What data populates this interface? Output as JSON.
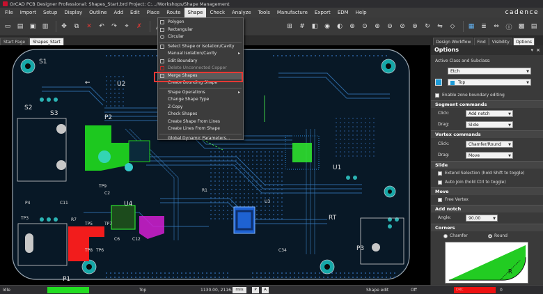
{
  "window": {
    "title": "OrCAD PCB Designer Professional: Shapes_Start.brd  Project: C:.../Workshops/Shape Management",
    "brand": "cadence"
  },
  "menubar": {
    "items": [
      "File",
      "Import",
      "Setup",
      "Display",
      "Outline",
      "Add",
      "Edit",
      "Place",
      "Route",
      "Shape",
      "Check",
      "Analyze",
      "Tools",
      "Manufacture",
      "Export",
      "EDM",
      "Help"
    ],
    "active": "Shape"
  },
  "tabs": [
    "Start Page",
    "Shapes_Start"
  ],
  "shape_menu": {
    "items": [
      {
        "label": "Polygon",
        "icon": "polygon-icon"
      },
      {
        "label": "Rectangular",
        "icon": "rectangle-icon"
      },
      {
        "label": "Circular",
        "icon": "circle-icon"
      },
      {
        "label": "Select Shape or Isolation/Cavity",
        "icon": "select-shape-icon"
      },
      {
        "label": "Manual Isolation/Cavity",
        "icon": "",
        "submenu": true
      },
      {
        "label": "Edit Boundary",
        "icon": "edit-boundary-icon"
      },
      {
        "label": "Delete Unconnected Copper",
        "icon": "delete-copper-icon"
      },
      {
        "label": "Merge Shapes",
        "icon": "merge-shapes-icon"
      },
      {
        "label": "Create Bounding Shape",
        "icon": ""
      },
      {
        "label": "Shape Operations",
        "icon": "",
        "submenu": true
      },
      {
        "label": "Change Shape Type",
        "icon": ""
      },
      {
        "label": "Z-Copy",
        "icon": ""
      },
      {
        "label": "Check Shapes",
        "icon": ""
      },
      {
        "label": "Create Shape From Lines",
        "icon": ""
      },
      {
        "label": "Create Lines From Shape",
        "icon": ""
      },
      {
        "label": "Global Dynamic Parameters...",
        "icon": ""
      }
    ],
    "highlighted": "Merge Shapes"
  },
  "board_labels": {
    "refs": [
      "S1",
      "S2",
      "S3",
      "P4",
      "U1",
      "U2",
      "U4",
      "R7",
      "TP5",
      "TP6",
      "TP7",
      "TP8",
      "TP9",
      "C11",
      "C2",
      "C6",
      "C12",
      "C34",
      "R1",
      "P1",
      "P3",
      "P2",
      "TP3",
      "RT",
      "U3"
    ],
    "arrow_glyph": "←"
  },
  "right_panel": {
    "tabs": [
      "Design Workflow",
      "Find",
      "Visibility",
      "Options"
    ],
    "active_tab": "Options",
    "header": "Options",
    "pin_glyph": "▾",
    "close_glyph": "×",
    "active_class_label": "Active Class and Subclass:",
    "class_value": "Etch",
    "subclass_value": "Top",
    "subclass_color": "#1e9bd7",
    "zone_boundary_label": "Enable zone boundary editing",
    "segment": {
      "title": "Segment commands",
      "click_label": "Click:",
      "click_value": "Add notch",
      "drag_label": "Drag:",
      "drag_value": "Slide"
    },
    "vertex": {
      "title": "Vertex commands",
      "click_label": "Click:",
      "click_value": "Chamfer/Round",
      "drag_label": "Drag:",
      "drag_value": "Move"
    },
    "slide": {
      "title": "Slide",
      "extend_label": "Extend Selection (hold Shift to toggle)",
      "autojoin_label": "Auto Join (hold Ctrl to toggle)"
    },
    "move": {
      "title": "Move",
      "free_vertex_label": "Free Vertex"
    },
    "notch": {
      "title": "Add notch",
      "angle_label": "Angle:",
      "angle_value": "90.00"
    },
    "corners": {
      "title": "Corners",
      "chamfer_label": "Chamfer",
      "round_label": "Round",
      "selected": "Round",
      "picture_glyph": "R"
    }
  },
  "statusbar": {
    "state": "Idle",
    "layer": "Top",
    "coords": "1130.00, 2116.00",
    "units": "mils",
    "p_btn": "P",
    "a_btn": "A",
    "mode": "Shape edit",
    "dyn": "Off",
    "drc_label": "DRC",
    "drc_count": "0",
    "idle_color": "#22dd22",
    "drc_color": "#ee1111"
  },
  "colors": {
    "board": "#0b2a3a",
    "copper_green": "#1fd21f",
    "pad_teal": "#16a7a7",
    "trace_blue": "#2f6fae",
    "highlight_red": "#e53935"
  }
}
